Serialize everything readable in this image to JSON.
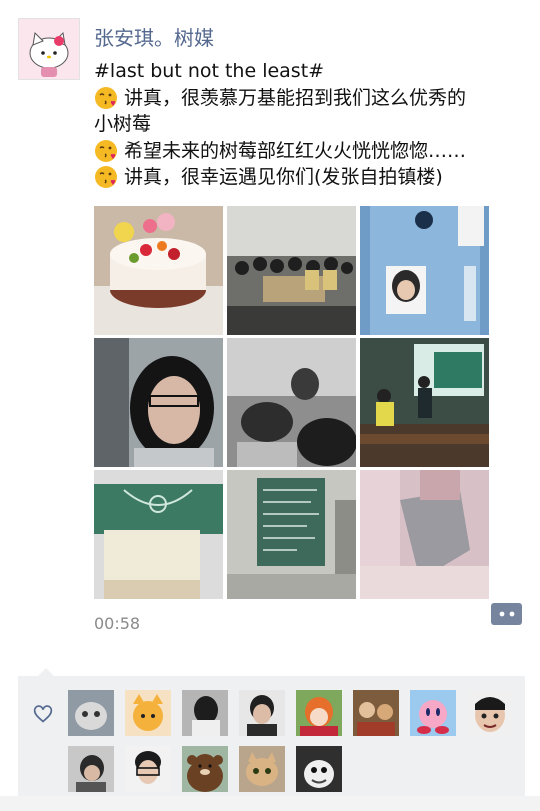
{
  "post": {
    "author": "张安琪。树媒",
    "lines": [
      "#last but not the least#",
      "讲真，很羡慕万基能招到我们这么优秀的",
      "小树莓",
      "希望未来的树莓部红红火火恍恍惚惚……",
      "讲真，很幸运遇见你们(发张自拍镇楼)"
    ],
    "time": "00:58"
  },
  "icons": {
    "avatar": "hello-kitty-avatar",
    "emoji": "kiss-emoji",
    "comment": "comment-icon",
    "like": "heart-icon"
  },
  "colors": {
    "author": "#55698f",
    "like_panel": "#eef0f2",
    "comment_button": "#76849e"
  }
}
